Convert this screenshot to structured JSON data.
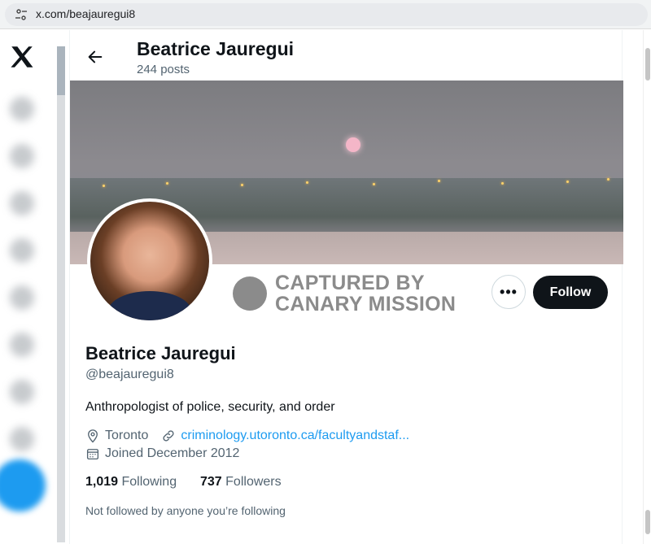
{
  "browser": {
    "url": "x.com/beajauregui8"
  },
  "header": {
    "name": "Beatrice Jauregui",
    "posts": "244 posts"
  },
  "stamp": {
    "line1": "CAPTURED BY",
    "line2": "CANARY MISSION"
  },
  "actions": {
    "more": "•••",
    "follow": "Follow"
  },
  "profile": {
    "name": "Beatrice Jauregui",
    "handle": "@beajauregui8",
    "bio": "Anthropologist of police, security, and order",
    "location": "Toronto",
    "website": "criminology.utoronto.ca/facultyandstaf...",
    "joined": "Joined December 2012"
  },
  "stats": {
    "following_count": "1,019",
    "following_label": "Following",
    "followers_count": "737",
    "followers_label": "Followers"
  },
  "note": "Not followed by anyone you’re following",
  "colors": {
    "accent": "#1d9bf0",
    "text": "#0f1419",
    "muted": "#536471"
  }
}
